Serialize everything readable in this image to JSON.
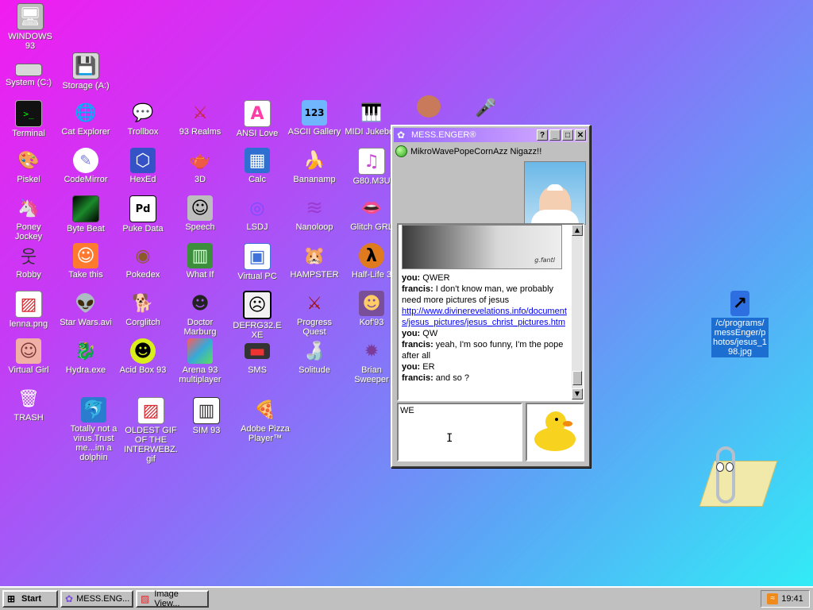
{
  "desktop": {
    "icons": [
      {
        "label": "WINDOWS 93",
        "glyph": "🖥",
        "bg": "#c0c0c0"
      },
      {
        "label": "System (C:)",
        "glyph": "▭",
        "bg": "#d8d8d8"
      },
      {
        "label": "Storage (A:)",
        "glyph": "💾",
        "bg": "#d8d8d8"
      },
      {
        "label": "Terminal",
        "glyph": ">_",
        "bg": "#111111"
      },
      {
        "label": "Cat Explorer",
        "glyph": "🌐",
        "bg": "#2e8b57"
      },
      {
        "label": "Trollbox",
        "glyph": "💬",
        "bg": "#4fb0ff"
      },
      {
        "label": "93 Realms",
        "glyph": "⚔",
        "bg": "#c4283a"
      },
      {
        "label": "ANSI Love",
        "glyph": "A",
        "bg": "#ff3da6"
      },
      {
        "label": "ASCII Gallery",
        "glyph": "123",
        "bg": "#6fb6ff"
      },
      {
        "label": "MIDI Jukebox",
        "glyph": "🎹",
        "bg": "#222222"
      },
      {
        "label": "Piskel",
        "glyph": "🎨",
        "bg": "#e9b45a"
      },
      {
        "label": "CodeMirror",
        "glyph": "✎",
        "bg": "#7a7ad6"
      },
      {
        "label": "HexEd",
        "glyph": "⬡",
        "bg": "#3552c7"
      },
      {
        "label": "3D",
        "glyph": "🫖",
        "bg": "#e39b9b"
      },
      {
        "label": "Calc",
        "glyph": "▦",
        "bg": "#2f6fd1"
      },
      {
        "label": "Bananamp",
        "glyph": "🍌",
        "bg": "#f6d42c"
      },
      {
        "label": "G80.M3U",
        "glyph": "♫",
        "bg": "#c94dd6"
      },
      {
        "label": "Poney Jockey",
        "glyph": "🦄",
        "bg": "#a45cc8"
      },
      {
        "label": "Byte Beat",
        "glyph": "▤",
        "bg": "#1b8a2b"
      },
      {
        "label": "Puke Data",
        "glyph": "Pd",
        "bg": "#ffffff"
      },
      {
        "label": "Speech",
        "glyph": "☺",
        "bg": "#bdbdbd"
      },
      {
        "label": "LSDJ",
        "glyph": "◎",
        "bg": "#7d4cff"
      },
      {
        "label": "Nanoloop",
        "glyph": "≋",
        "bg": "#9b3bd1"
      },
      {
        "label": "Glitch GRL",
        "glyph": "👄",
        "bg": "#e42f5a"
      },
      {
        "label": "Robby",
        "glyph": "웃",
        "bg": "#e8e8e8"
      },
      {
        "label": "Take this",
        "glyph": "☺",
        "bg": "#ff7a2e"
      },
      {
        "label": "Pokedex",
        "glyph": "◉",
        "bg": "#c89a5a"
      },
      {
        "label": "What If",
        "glyph": "▥",
        "bg": "#3c8d3c"
      },
      {
        "label": "Virtual PC",
        "glyph": "▣",
        "bg": "#3f73d9"
      },
      {
        "label": "HAMPSTER",
        "glyph": "🐹",
        "bg": "#cfa47a"
      },
      {
        "label": "Half-Life 3",
        "glyph": "λ",
        "bg": "#e07a1f"
      },
      {
        "label": "lenna.png",
        "glyph": "🖼",
        "bg": "#d8262c"
      },
      {
        "label": "Star Wars.avi",
        "glyph": "👽",
        "bg": "#6fa14e"
      },
      {
        "label": "Corglitch",
        "glyph": "🐕",
        "bg": "#e79a52"
      },
      {
        "label": "Doctor Marburg",
        "glyph": "☻",
        "bg": "#cfcfcf"
      },
      {
        "label": "DEFRG32.EXE",
        "glyph": "☹",
        "bg": "#f2f2f2"
      },
      {
        "label": "Progress Quest",
        "glyph": "⚔",
        "bg": "#b8b8b8"
      },
      {
        "label": "Kof'93",
        "glyph": "☻",
        "bg": "#7a4f9a"
      },
      {
        "label": "Virtual Girl",
        "glyph": "☺",
        "bg": "#f1b0a5"
      },
      {
        "label": "Hydra.exe",
        "glyph": "🐉",
        "bg": "#3a8d3a"
      },
      {
        "label": "Acid Box 93",
        "glyph": "☻",
        "bg": "#d9ee1a"
      },
      {
        "label": "Arena 93 multiplayer",
        "glyph": "⬢",
        "bg": "#36a9d9"
      },
      {
        "label": "SMS",
        "glyph": "▬",
        "bg": "#333333"
      },
      {
        "label": "Solitude",
        "glyph": "🍶",
        "bg": "#74c4f0"
      },
      {
        "label": "Brian Sweeper",
        "glyph": "✹",
        "bg": "#7a3b9a"
      },
      {
        "label": "TRASH",
        "glyph": "🗑",
        "bg": "#d8d8d8"
      },
      {
        "label": "Totally not a virus.Trust me...im a dolphin",
        "glyph": "🐬",
        "bg": "#2a7ccf"
      },
      {
        "label": "OLDEST GIF OF THE INTERWEBZ.gif",
        "glyph": "🖼",
        "bg": "#d8262c"
      },
      {
        "label": "SIM 93",
        "glyph": "▥",
        "bg": "#e8e8e8"
      },
      {
        "label": "Adobe Pizza Player™",
        "glyph": "🍕",
        "bg": "#e7b55a"
      },
      {
        "label": "/c/programs/messEnger/photos/jesus_198.jpg",
        "glyph": "↗",
        "bg": "#2d6fe0"
      }
    ]
  },
  "messenger": {
    "title": "MESS.ENGER®",
    "help_label": "?",
    "minimize_label": "_",
    "maximize_label": "□",
    "close_label": "✕",
    "contact_status": "MikroWavePopeCornAzz Nigazz!!",
    "image_signature": "g.fantl",
    "messages": [
      {
        "who": "you:",
        "text": " QWER"
      },
      {
        "who": "francis:",
        "text": " I don't know man, we probably need more pictures of jesus"
      },
      {
        "who": "",
        "link": "http://www.divinerevelations.info/documents/jesus_pictures/jesus_christ_pictures.htm"
      },
      {
        "who": "you:",
        "text": " QW"
      },
      {
        "who": "francis:",
        "text": " yeah, I'm soo funny, I'm the pope after all"
      },
      {
        "who": "you:",
        "text": " ER"
      },
      {
        "who": "francis:",
        "text": " and so ?"
      }
    ],
    "input_value": "WE",
    "scroll_up": "▲",
    "scroll_down": "▼"
  },
  "taskbar": {
    "start_label": "Start",
    "tasks": [
      {
        "label": "MESS.ENG..."
      },
      {
        "label": "Image View..."
      }
    ],
    "clock": "19:41",
    "rss_glyph": "≈"
  },
  "cursor_glyph": "I"
}
